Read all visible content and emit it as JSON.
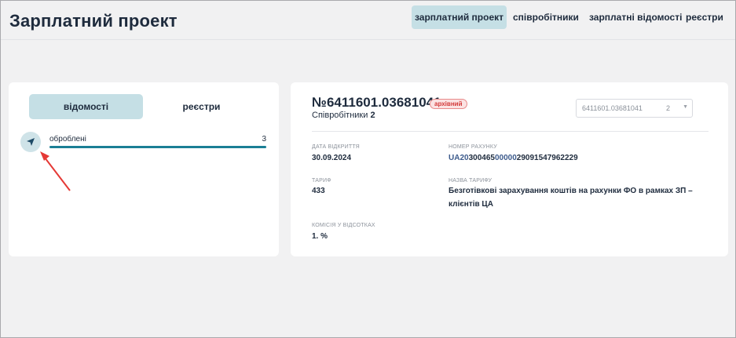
{
  "header": {
    "title": "Зарплатний проект",
    "tabs": [
      {
        "label": "зарплатний проект",
        "active": true
      },
      {
        "label": "співробітники",
        "active": false
      },
      {
        "label": "зарплатні відомості",
        "active": false
      },
      {
        "label": "реєстри",
        "active": false
      }
    ]
  },
  "left_panel": {
    "segments": [
      {
        "label": "відомості",
        "active": true
      },
      {
        "label": "реєстри",
        "active": false
      }
    ],
    "rows": [
      {
        "icon": "paper-plane-icon",
        "label": "оброблені",
        "count": "3",
        "progress": 1.0
      }
    ]
  },
  "statement": {
    "number": "№6411601.03681041",
    "badge": "архівний",
    "employees_label": "Співробітники",
    "employees_count": "2",
    "select": {
      "value": "6411601.03681041",
      "count": "2"
    },
    "fields": {
      "open_date_label": "ДАТА ВІДКРИТТЯ",
      "open_date": "30.09.2024",
      "account_label": "НОМЕР РАХУНКУ",
      "account_parts": [
        "UA20",
        "300465",
        "00000",
        "29091547962229"
      ],
      "tariff_label": "ТАРИФ",
      "tariff": "433",
      "tariff_name_label": "НАЗВА ТАРИФУ",
      "tariff_name_line1": "Безготівкові зарахування коштів на рахунки ФО в рамках ЗП –",
      "tariff_name_line2": "клієнтів ЦА",
      "commission_label": "КОМІСІЯ У ВІДСОТКАХ",
      "commission": "1. %"
    }
  },
  "colors": {
    "accent": "#c5dfe5",
    "progress": "#1b7f95",
    "badge": "#d33a3a",
    "annotation_arrow": "#e53935"
  }
}
